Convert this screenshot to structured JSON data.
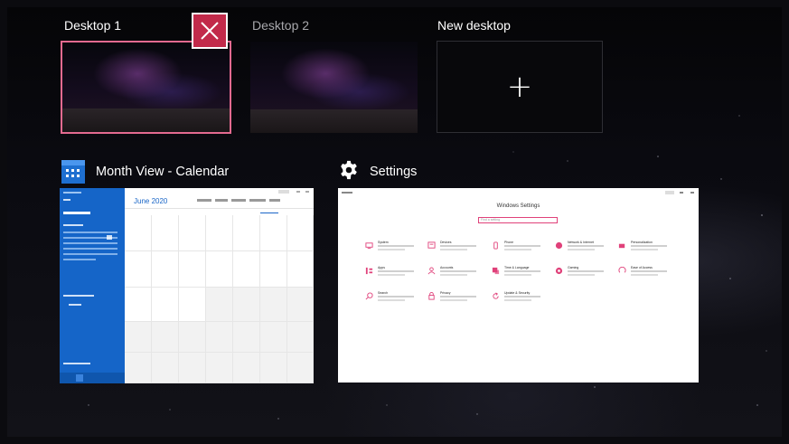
{
  "desktops": [
    {
      "label": "Desktop 1"
    },
    {
      "label": "Desktop 2"
    },
    {
      "label": "New desktop",
      "plus_glyph": "+"
    }
  ],
  "close_button": {
    "icon": "close-icon"
  },
  "windows": {
    "calendar": {
      "title": "Month View - Calendar",
      "icon": "calendar-icon",
      "month_label": "June 2020"
    },
    "settings": {
      "title": "Settings",
      "icon": "gear-icon",
      "window_caption": "Windows Settings",
      "search_placeholder": "Find a setting",
      "items": [
        {
          "label": "System",
          "icon": "display-icon"
        },
        {
          "label": "Devices",
          "icon": "keyboard-icon"
        },
        {
          "label": "Phone",
          "icon": "phone-icon"
        },
        {
          "label": "Network & Internet",
          "icon": "globe-icon"
        },
        {
          "label": "Personalization",
          "icon": "brush-icon"
        },
        {
          "label": "Apps",
          "icon": "apps-icon"
        },
        {
          "label": "Accounts",
          "icon": "person-icon"
        },
        {
          "label": "Time & Language",
          "icon": "clock-icon"
        },
        {
          "label": "Gaming",
          "icon": "controller-icon"
        },
        {
          "label": "Ease of Access",
          "icon": "access-icon"
        },
        {
          "label": "Search",
          "icon": "search-icon"
        },
        {
          "label": "Privacy",
          "icon": "lock-icon"
        },
        {
          "label": "Update & Security",
          "icon": "update-icon"
        }
      ]
    }
  },
  "colors": {
    "accent_close": "#c22a4a",
    "selected_border": "#e36a90",
    "calendar_blue": "#1565c8",
    "settings_icon_pink": "#e0417a"
  }
}
